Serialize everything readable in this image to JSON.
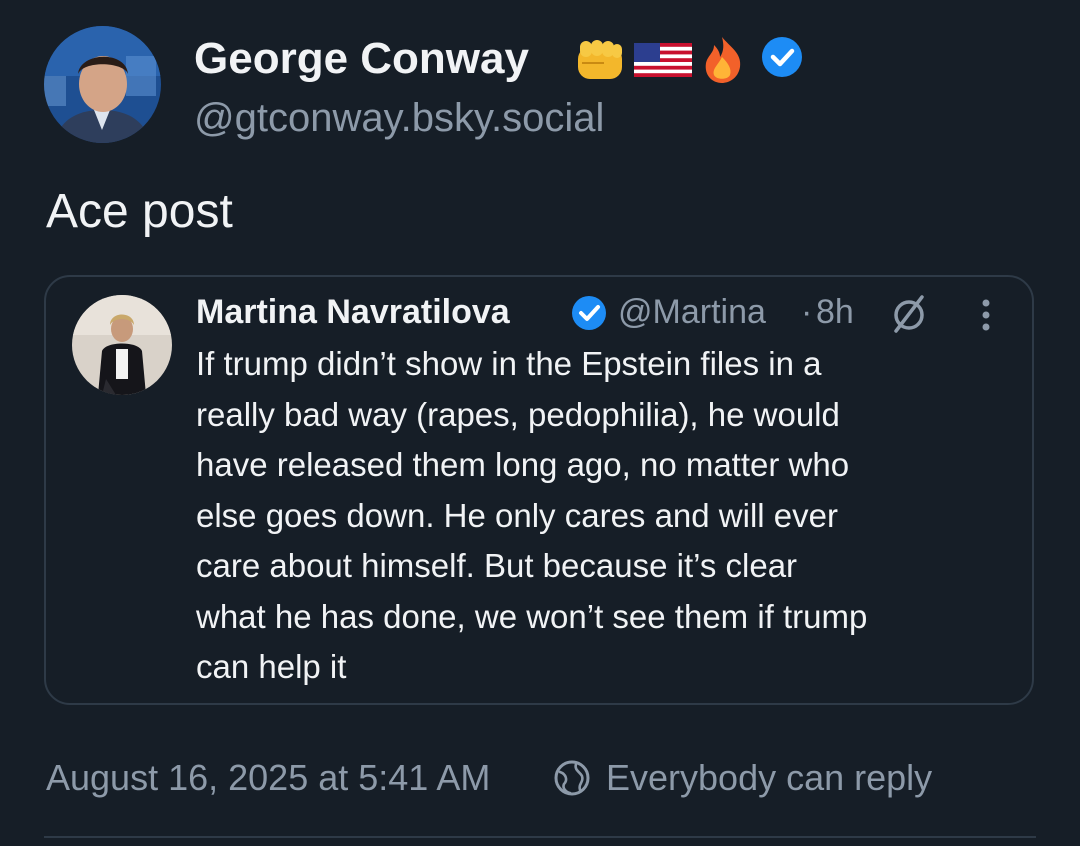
{
  "post": {
    "author": {
      "name": "George Conway",
      "emoji": "👊🇺🇸🔥",
      "verified": true,
      "handle": "@gtconway.bsky.social"
    },
    "text": "Ace post"
  },
  "quote": {
    "author": {
      "name": "Martina Navratilova",
      "verified": true,
      "handle": "@Martina",
      "separator": "·",
      "time": "8h"
    },
    "lines": [
      "If trump didn’t show in the Epstein files in a",
      "really bad way (rapes, pedophilia), he would",
      "have released them long ago, no matter who",
      "else goes down. He only cares and will ever",
      "care about himself. But because it’s clear",
      "what he has done, we won’t see them if trump",
      "can help it"
    ]
  },
  "footer": {
    "timestamp": "August 16, 2025 at 5:41 AM",
    "reply_setting": "Everybody can reply"
  },
  "icons": {
    "verified": "verified-badge-icon",
    "no_reply": "replies-disabled-icon",
    "more": "more-options-icon",
    "reply_setting": "globe-icon"
  },
  "colors": {
    "background": "#161e27",
    "text_primary": "#f1f3f5",
    "text_secondary": "#8d9aa9",
    "border": "#2e3a47",
    "verified": "#1d8cf5"
  }
}
